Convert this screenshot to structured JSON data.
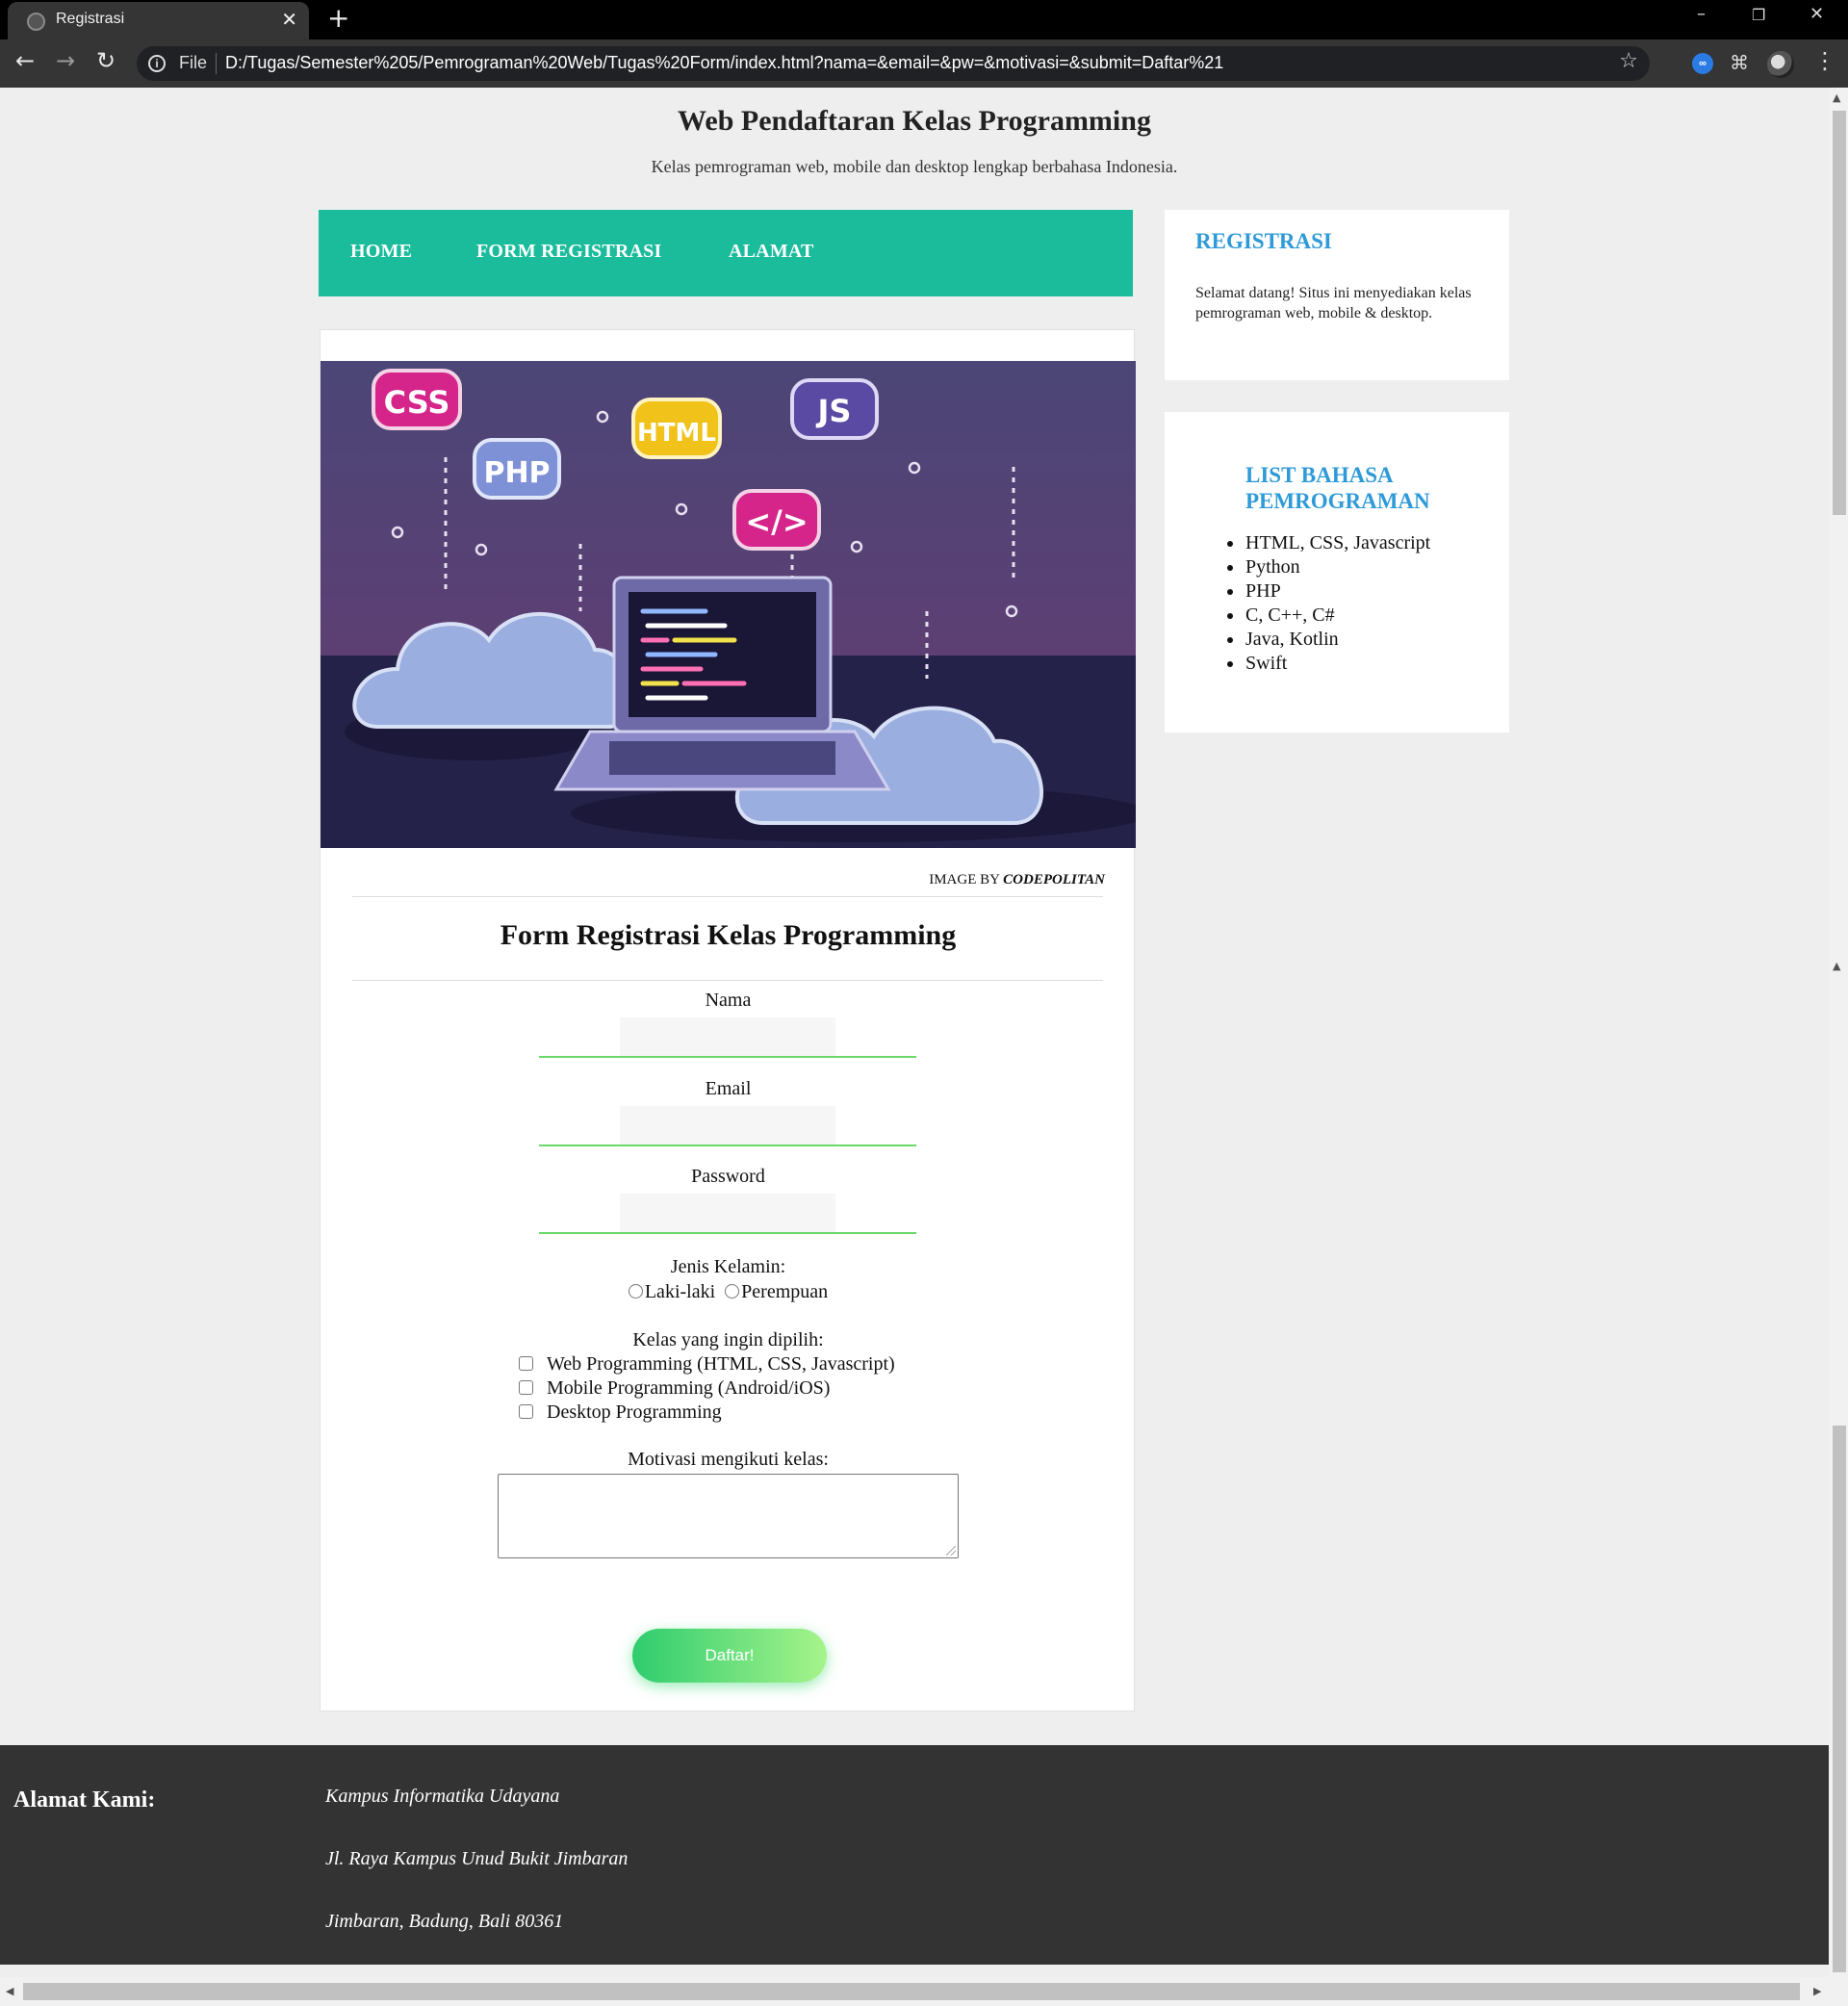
{
  "browser": {
    "tab_title": "Registrasi",
    "tab_close": "✕",
    "new_tab": "+",
    "file_label": "File",
    "url": "D:/Tugas/Semester%205/Pemrograman%20Web/Tugas%20Form/index.html?nama=&email=&pw=&motivasi=&submit=Daftar%21",
    "icons": [
      "back-icon",
      "forward-icon",
      "reload-icon",
      "info-icon",
      "star-icon",
      "extension-icon",
      "puzzle-icon",
      "avatar",
      "menu-icon"
    ]
  },
  "header": {
    "title": "Web Pendaftaran Kelas Programming",
    "subtitle": "Kelas pemrograman web, mobile dan desktop lengkap berbahasa Indonesia."
  },
  "nav": {
    "items": [
      "HOME",
      "FORM REGISTRASI",
      "ALAMAT"
    ],
    "color": "#1abc9c"
  },
  "hero": {
    "badges": [
      "CSS",
      "PHP",
      "HTML",
      "JS",
      "</>"
    ],
    "credit_prefix": "IMAGE BY ",
    "credit_name": "CODEPOLITAN"
  },
  "form": {
    "title": "Form Registrasi Kelas Programming",
    "nama_label": "Nama",
    "email_label": "Email",
    "password_label": "Password",
    "gender_label": "Jenis Kelamin:",
    "gender_options": [
      "Laki-laki",
      "Perempuan"
    ],
    "classes_label": "Kelas yang ingin dipilih:",
    "class_options": [
      "Web Programming (HTML, CSS, Javascript)",
      "Mobile Programming (Android/iOS)",
      "Desktop Programming"
    ],
    "motivation_label": "Motivasi mengikuti kelas:",
    "submit_label": "Daftar!"
  },
  "sidebar": {
    "registration_title": "REGISTRASI",
    "registration_text": "Selamat datang! Situs ini menyediakan kelas pemrograman web, mobile & desktop.",
    "languages_title": "LIST BAHASA PEMROGRAMAN",
    "languages": [
      "HTML, CSS, Javascript",
      "Python",
      "PHP",
      "C, C++, C#",
      "Java, Kotlin",
      "Swift"
    ],
    "accent_color": "#2e9ad8"
  },
  "footer": {
    "heading": "Alamat Kami:",
    "lines": [
      "Kampus Informatika Udayana",
      "Jl. Raya Kampus Unud Bukit Jimbaran",
      "Jimbaran, Badung, Bali 80361"
    ]
  }
}
